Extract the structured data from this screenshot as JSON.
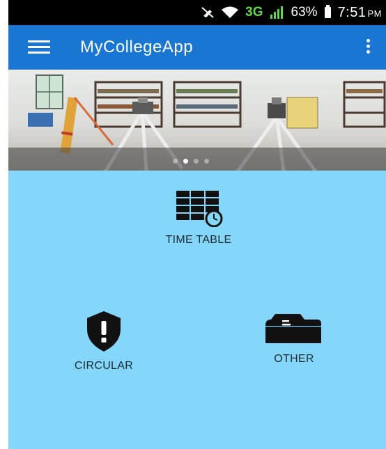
{
  "status_bar": {
    "network": "3G",
    "battery": "63%",
    "time": "7:51",
    "ampm": "PM",
    "icons": [
      "mute-icon",
      "wifi-icon",
      "signal-icon",
      "battery-icon"
    ]
  },
  "app_bar": {
    "title": "MyCollegeApp",
    "color": "#1976d2",
    "icons": [
      "menu-icon",
      "overflow-menu-icon"
    ]
  },
  "banner": {
    "slide_count": 4,
    "active_index": 1
  },
  "tiles": [
    {
      "label": "TIME TABLE",
      "icon": "timetable-icon"
    },
    {
      "label": "CIRCULAR",
      "icon": "shield-alert-icon"
    },
    {
      "label": "OTHER",
      "icon": "inbox-icon"
    }
  ],
  "colors": {
    "background": "#84d7fb",
    "accent_green": "#62d64e"
  }
}
